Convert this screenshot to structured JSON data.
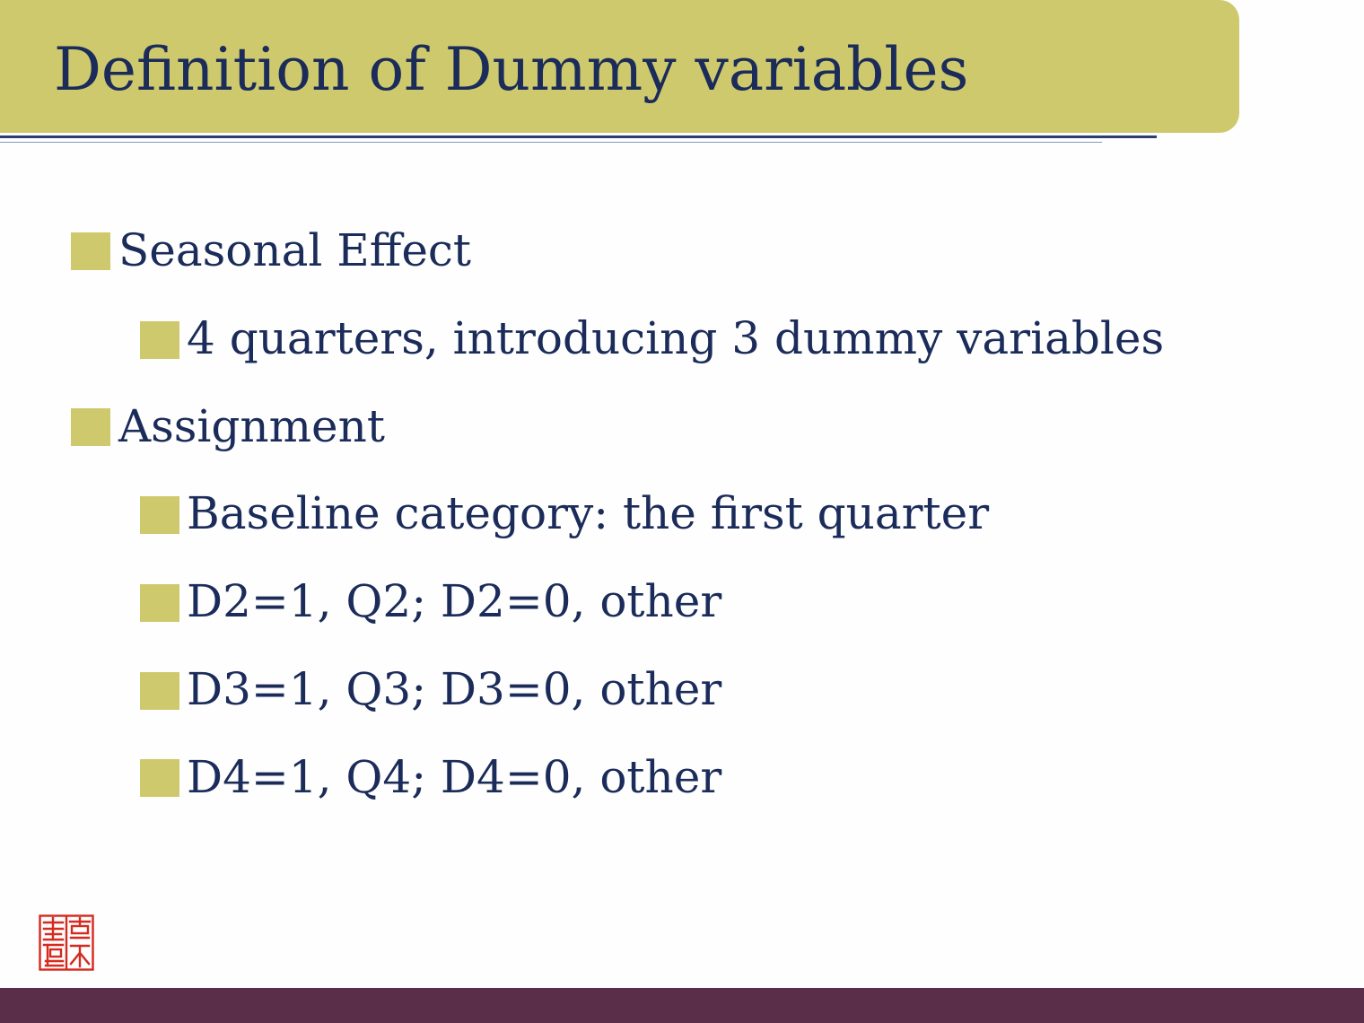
{
  "slide": {
    "title": "Definition of Dummy variables",
    "bullets": [
      {
        "level": 1,
        "text": "Seasonal Effect"
      },
      {
        "level": 2,
        "text": "4 quarters, introducing 3 dummy variables"
      },
      {
        "level": 1,
        "text": "Assignment"
      },
      {
        "level": 2,
        "text": "Baseline category: the first quarter"
      },
      {
        "level": 2,
        "text": "D2=1, Q2; D2=0, other"
      },
      {
        "level": 2,
        "text": "D3=1, Q3; D3=0, other"
      },
      {
        "level": 2,
        "text": "D4=1, Q4; D4=0, other"
      }
    ]
  },
  "colors": {
    "title_bar": "#cfc96d",
    "bullet": "#cfc96d",
    "text": "#1b2c5a",
    "footer": "#5a2d48",
    "seal": "#d42a1f"
  },
  "icons": {
    "seal": "university-seal-icon"
  }
}
